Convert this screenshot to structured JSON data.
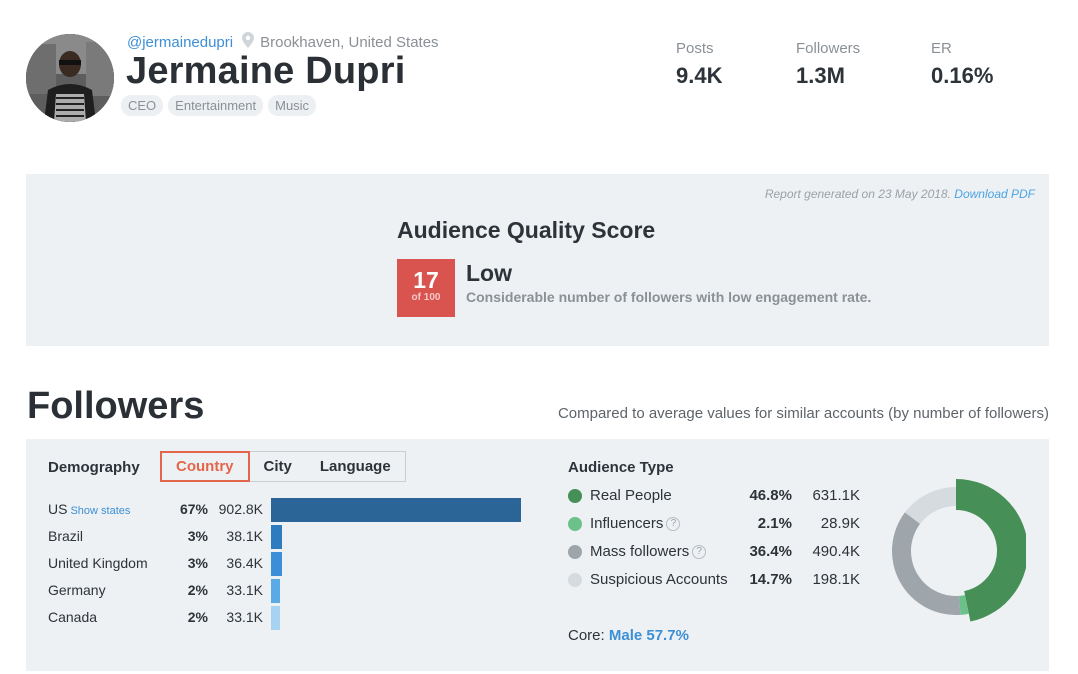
{
  "profile": {
    "handle": "@jermainedupri",
    "location": "Brookhaven, United States",
    "name": "Jermaine Dupri",
    "tags": [
      "CEO",
      "Entertainment",
      "Music"
    ]
  },
  "stats": [
    {
      "label": "Posts",
      "value": "9.4K"
    },
    {
      "label": "Followers",
      "value": "1.3M"
    },
    {
      "label": "ER",
      "value": "0.16%"
    }
  ],
  "quality": {
    "report_text": "Report generated on 23 May 2018.",
    "download_label": "Download PDF",
    "title": "Audience Quality Score",
    "score": "17",
    "score_of": "of 100",
    "score_label": "Low",
    "score_desc": "Considerable number of followers with low engagement rate.",
    "score_color": "#d9534f"
  },
  "followers": {
    "heading": "Followers",
    "compared": "Compared to average values for similar accounts (by number of followers)"
  },
  "demography": {
    "label": "Demography",
    "tabs": [
      "Country",
      "City",
      "Language"
    ],
    "active_tab": "Country",
    "show_states": "Show states",
    "countries": [
      {
        "name": "US",
        "pct": "67%",
        "count": "902.8K",
        "share": 67,
        "color": "#2b6496"
      },
      {
        "name": "Brazil",
        "pct": "3%",
        "count": "38.1K",
        "share": 3,
        "color": "#2f7bc0"
      },
      {
        "name": "United Kingdom",
        "pct": "3%",
        "count": "36.4K",
        "share": 3,
        "color": "#3a8fd6"
      },
      {
        "name": "Germany",
        "pct": "2%",
        "count": "33.1K",
        "share": 2,
        "color": "#5aaae6"
      },
      {
        "name": "Canada",
        "pct": "2%",
        "count": "33.1K",
        "share": 2,
        "color": "#a6d3f2"
      }
    ]
  },
  "audience": {
    "label": "Audience Type",
    "types": [
      {
        "name": "Real People",
        "pct": "46.8%",
        "count": "631.1K",
        "share": 46.8,
        "color": "#468f57",
        "help": false
      },
      {
        "name": "Influencers",
        "pct": "2.1%",
        "count": "28.9K",
        "share": 2.1,
        "color": "#6cc08a",
        "help": true
      },
      {
        "name": "Mass followers",
        "pct": "36.4%",
        "count": "490.4K",
        "share": 36.4,
        "color": "#9ea5ab",
        "help": true
      },
      {
        "name": "Suspicious Accounts",
        "pct": "14.7%",
        "count": "198.1K",
        "share": 14.7,
        "color": "#d6dbe0",
        "help": false
      }
    ],
    "core_label": "Core:",
    "core_value": "Male 57.7%"
  },
  "icons": {
    "help": "?",
    "location": "map-pin-icon"
  }
}
